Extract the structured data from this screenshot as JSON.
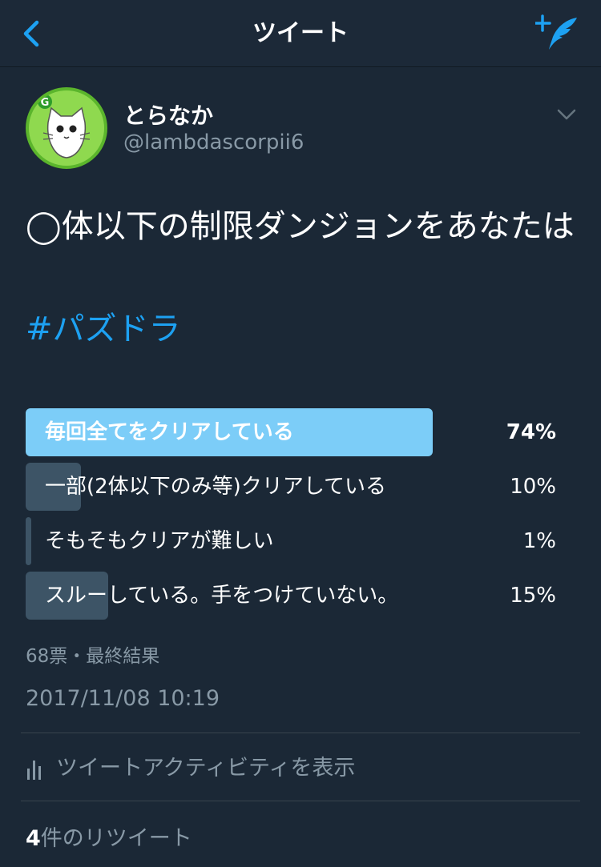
{
  "nav": {
    "title": "ツイート",
    "back_icon": "chevron-left-icon",
    "compose_icon": "compose-tweet-icon",
    "accent": "#1da1f2"
  },
  "author": {
    "display_name": "とらなか",
    "handle": "@lambdascorpii6",
    "avatar_icon": "cat-avatar",
    "menu_icon": "chevron-down-icon"
  },
  "tweet": {
    "text": "◯体以下の制限ダンジョンをあなたは",
    "hashtag": "#パズドラ"
  },
  "poll": {
    "options": [
      {
        "label": "毎回全てをクリアしている",
        "percent": "74%",
        "value": 74,
        "winner": true
      },
      {
        "label": "一部(2体以下のみ等)クリアしている",
        "percent": "10%",
        "value": 10,
        "winner": false
      },
      {
        "label": "そもそもクリアが難しい",
        "percent": "1%",
        "value": 1,
        "winner": false
      },
      {
        "label": "スルーしている。手をつけていない。",
        "percent": "15%",
        "value": 15,
        "winner": false
      }
    ],
    "winner_color": "#7ccdf8",
    "other_color": "#3d5466",
    "votes_text": "68票・最終結果"
  },
  "timestamp": "2017/11/08 10:19",
  "activity_label": "ツイートアクティビティを表示",
  "retweets": {
    "count": "4",
    "label": "件のリツイート"
  }
}
